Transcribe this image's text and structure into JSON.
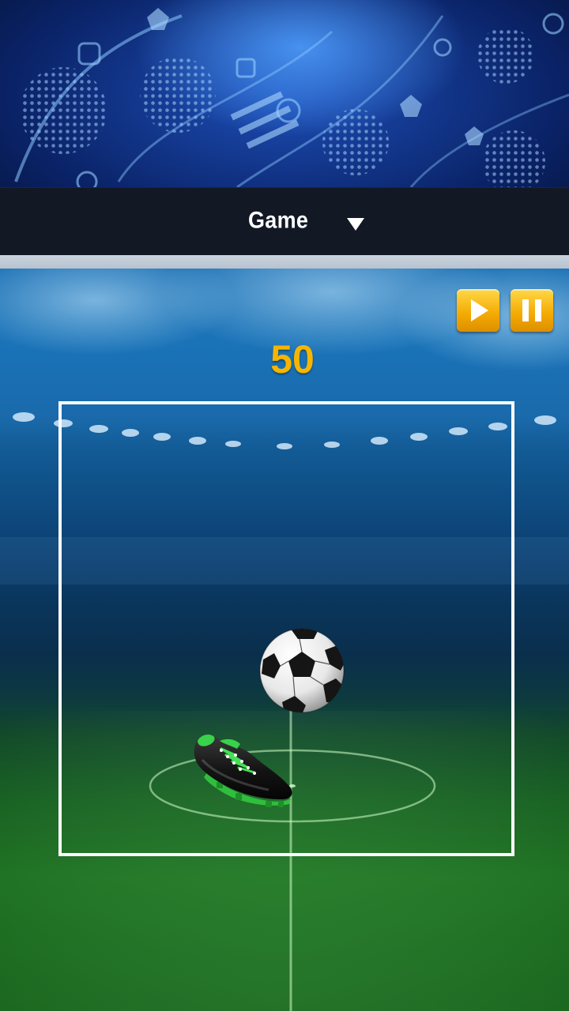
{
  "header": {
    "title": "Game",
    "dropdown_icon": "caret-down-icon"
  },
  "game": {
    "score": "50",
    "controls": {
      "play_icon": "play-icon",
      "pause_icon": "pause-icon",
      "accent_color": "#f6b500"
    },
    "objects": [
      "soccer-ball",
      "football-boot"
    ]
  }
}
